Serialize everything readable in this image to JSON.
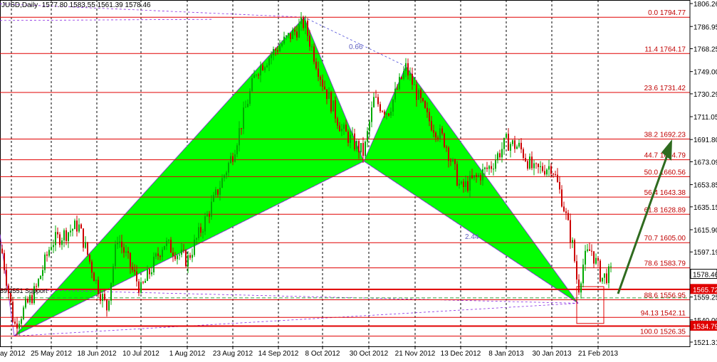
{
  "header": {
    "title": "JUSD,Daily",
    "ohlc": "1577.80 1583.55 1561.39 1578.46"
  },
  "chart_data": {
    "type": "candlestick",
    "symbol": "JUSD",
    "timeframe": "Daily",
    "ylim": [
      1521.31,
      1806.26
    ],
    "y_ticks": [
      1806.26,
      1786.95,
      1768.25,
      1749.0,
      1730.29,
      1711.05,
      1691.8,
      1673.09,
      1653.85,
      1635.15,
      1615.9,
      1597.19,
      1578.46,
      1559.25,
      1540.0,
      1521.31
    ],
    "y_tick_labels": [
      "1806.26",
      "1786.95",
      "1768.25",
      "1749.00",
      "1730.29",
      "1711.05",
      "1691.80",
      "1673.09",
      "1653.85",
      "1635.15",
      "1615.90",
      "1597.19",
      "1578.46",
      "1559.25",
      "1540.00",
      "1521.31"
    ],
    "x_tick_labels": [
      "ay 2012",
      "25 May 2012",
      "18 Jun 2012",
      "10 Jul 2012",
      "1 Aug 2012",
      "23 Aug 2012",
      "14 Sep 2012",
      "8 Oct 2012",
      "30 Oct 2012",
      "21 Nov 2012",
      "13 Dec 2012",
      "8 Jan 2013",
      "30 Jan 2013",
      "21 Feb 2013"
    ],
    "fib_levels": [
      {
        "label": "0.0 1794.77",
        "value": 1794.77
      },
      {
        "label": "11.4 1764.17",
        "value": 1764.17
      },
      {
        "label": "23.6 1731.42",
        "value": 1731.42
      },
      {
        "label": "38.2 1692.23",
        "value": 1692.23
      },
      {
        "label": "44.7 1674.79",
        "value": 1674.79
      },
      {
        "label": "50.0 1660.56",
        "value": 1660.56
      },
      {
        "label": "56.4 1643.38",
        "value": 1643.38
      },
      {
        "label": "61.8 1628.89",
        "value": 1628.89
      },
      {
        "label": "70.7 1605.00",
        "value": 1605.0
      },
      {
        "label": "78.6 1583.79",
        "value": 1583.79
      },
      {
        "label": "88.6 1556.95",
        "value": 1556.95
      },
      {
        "label": "94.13 1542.11",
        "value": 1542.11
      },
      {
        "label": "100.0 1526.35",
        "value": 1526.35
      }
    ],
    "price_labels": [
      {
        "label": "1578.46",
        "value": 1578.46,
        "style": "current"
      },
      {
        "label": "1565.72",
        "value": 1565.72,
        "style": "red"
      },
      {
        "label": "1534.79",
        "value": 1534.79,
        "style": "red"
      }
    ],
    "pattern_annotations": [
      "0.66",
      "2.44"
    ],
    "left_edge_label": "89 2551 Support"
  }
}
